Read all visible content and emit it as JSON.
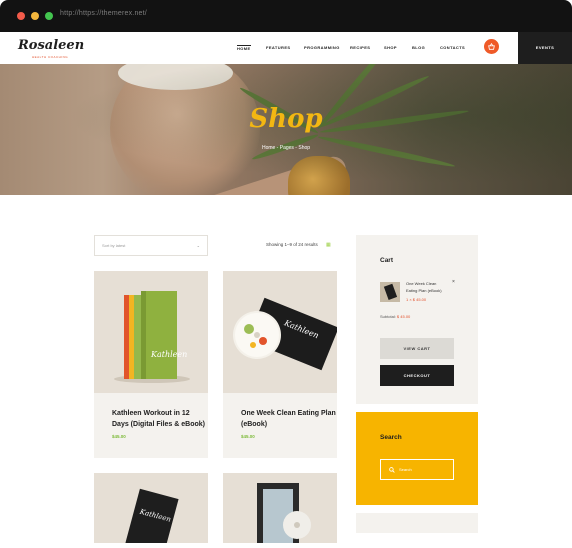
{
  "browser": {
    "url": "http://https://themerex.net/"
  },
  "header": {
    "logo": "Rosaleen",
    "logo_sub": "HEALTH COACHING",
    "nav": [
      "HOME",
      "FEATURES",
      "PROGRAMMING",
      "RECIPES",
      "SHOP",
      "BLOG",
      "CONTACTS"
    ],
    "events": "EVENTS"
  },
  "hero": {
    "title": "Shop",
    "breadcrumb": "Home  -  Pages  -  Shop"
  },
  "shop": {
    "sort_label": "Sort by latest",
    "showing": "Showing 1–9 of 24 results",
    "products": [
      {
        "title": "Kathleen Workout in 12 Days (Digital Files & eBook)",
        "price": "$45.00"
      },
      {
        "title": "One Week Clean Eating Plan (eBook)",
        "price": "$45.00"
      },
      {
        "title": "",
        "price": ""
      },
      {
        "title": "",
        "price": ""
      }
    ]
  },
  "sidebar": {
    "cart": {
      "title": "Cart",
      "item_name": "One Week Clean Eating Plan (eBook)",
      "item_qty_price": "1 × $ 45.00",
      "subtotal_label": "Subtotal:",
      "subtotal_value": "$ 45.00",
      "view_cart": "VIEW CART",
      "checkout": "CHECKOUT"
    },
    "search": {
      "title": "Search",
      "placeholder": "Search"
    }
  },
  "colors": {
    "accent_orange": "#ef5a28",
    "accent_yellow": "#f7b400",
    "price_green": "#7dbb3a",
    "dark": "#1e1e1e"
  }
}
